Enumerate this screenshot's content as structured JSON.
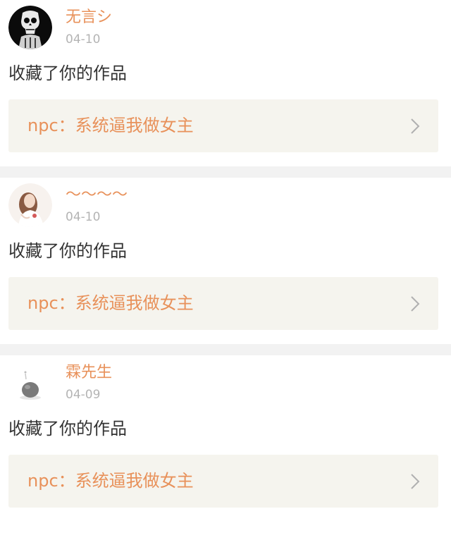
{
  "notifications": [
    {
      "username": "无言シ",
      "date": "04-10",
      "action": "收藏了你的作品",
      "work_title": "npc：系统逼我做女主",
      "avatar_icon": "skull-avatar-icon"
    },
    {
      "username": "～～～～",
      "date": "04-10",
      "action": "收藏了你的作品",
      "work_title": "npc：系统逼我做女主",
      "avatar_icon": "girl-photo-avatar-icon"
    },
    {
      "username": "霖先生",
      "date": "04-09",
      "action": "收藏了你的作品",
      "work_title": "npc：系统逼我做女主",
      "avatar_icon": "stone-avatar-icon"
    }
  ],
  "colors": {
    "accent": "#e8915a",
    "date_gray": "#b4b4b4",
    "text_dark": "#333333",
    "card_bg": "#f5f4ee",
    "separator": "#f2f2f2"
  }
}
